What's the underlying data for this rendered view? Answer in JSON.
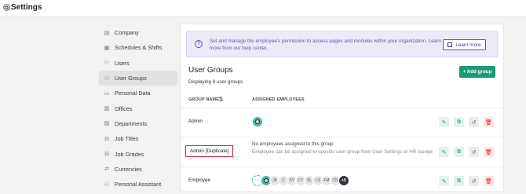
{
  "app": {
    "title": "Settings"
  },
  "sidebar": {
    "items": [
      {
        "label": "Company",
        "icon": "building-icon",
        "active": false
      },
      {
        "label": "Schedules & Shifts",
        "icon": "calendar-icon",
        "active": false
      },
      {
        "label": "Users",
        "icon": "users-icon",
        "active": false
      },
      {
        "label": "User Groups",
        "icon": "user-group-icon",
        "active": true
      },
      {
        "label": "Personal Data",
        "icon": "id-card-icon",
        "active": false
      },
      {
        "label": "Offices",
        "icon": "office-icon",
        "active": false
      },
      {
        "label": "Departments",
        "icon": "department-icon",
        "active": false
      },
      {
        "label": "Job Titles",
        "icon": "briefcase-icon",
        "active": false
      },
      {
        "label": "Job Grades",
        "icon": "briefcase-icon",
        "active": false
      },
      {
        "label": "Currencies",
        "icon": "exchange-icon",
        "active": false
      },
      {
        "label": "Personal Assistant",
        "icon": "assistant-icon",
        "active": false
      }
    ]
  },
  "info": {
    "text": "Set and manage the employee's permission to access pages and modules within your organization. Learn more from our help center.",
    "learn_more": "Learn more"
  },
  "groups": {
    "title": "User Groups",
    "subtitle": "Displaying 9 user groups",
    "add_label": "+ Add group",
    "columns": [
      "GROUP NAME",
      "ASSIGNED EMPLOYEES"
    ],
    "rows": [
      {
        "name": "Admin",
        "avatars": [
          "photo"
        ]
      },
      {
        "name": "Admin [Duplicate]",
        "highlighted": true,
        "empty_title": "No employees assigned to this group",
        "empty_text": "Employee can be assigned to specific user group from User Settings or HR lounge"
      },
      {
        "name": "Employee",
        "avatars": [
          "dashed",
          "photo",
          "JK",
          "C",
          "SY",
          "CY",
          "SL",
          "LS",
          "FM",
          "CN"
        ],
        "more": "+5"
      }
    ]
  },
  "colors": {
    "accent": "#1a9b73",
    "info": "#5a56b4",
    "danger": "#d7232e"
  }
}
